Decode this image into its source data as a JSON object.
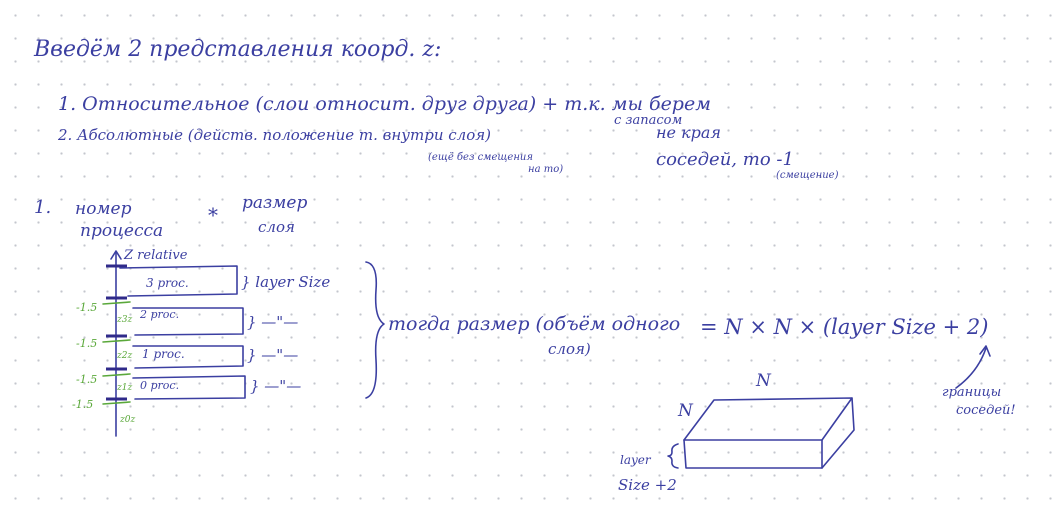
{
  "note": {
    "title": "Введём 2 представления коорд. z:",
    "item1": "1. Относительное (слои относит. друг друга) + т.к. мы берем",
    "item1_margin_a": "с запасом",
    "item1_margin_b": "не края",
    "item1_margin_c": "соседей, то -1",
    "item1_margin_d": "(смещение)",
    "item2": "2. Абсолютные (действ. положение т. внутри слоя)",
    "item2_sub_a": "(ещё без смещения",
    "item2_sub_b": "на то)",
    "formula_prefix": "1.",
    "formula_a_top": "номер",
    "formula_a_bottom": "процесса",
    "formula_op": "*",
    "formula_b_top": "размер",
    "formula_b_bottom": "слоя",
    "axis_label": "Z relative",
    "layers": [
      {
        "proc": "3 proc.",
        "bracket_label": "} layer Size"
      },
      {
        "proc": "2 proc.",
        "bracket_label": "} —\"—"
      },
      {
        "proc": "1 proc.",
        "bracket_label": "} —\"—"
      },
      {
        "proc": "0 proc.",
        "bracket_label": "} —\"—"
      }
    ],
    "offset_labels": [
      "-1.5",
      "-1.5",
      "-1.5",
      "-1.5"
    ],
    "sub_labels": [
      "z3z",
      "z2z",
      "z1z",
      "z0z"
    ],
    "then_a": "тогда размер (объём одного",
    "then_b": "слоя)",
    "size_formula": "=  N × N × (layer Size + 2)",
    "neighbors_a": "границы",
    "neighbors_b": "соседей!",
    "box_top_label": "N",
    "box_left_label": "N",
    "box_side_a": "layer",
    "box_side_b": "Size +2"
  },
  "colors": {
    "ink": "#3b3fa1",
    "green": "#5aa83a",
    "dots": "#c3c6cd"
  }
}
